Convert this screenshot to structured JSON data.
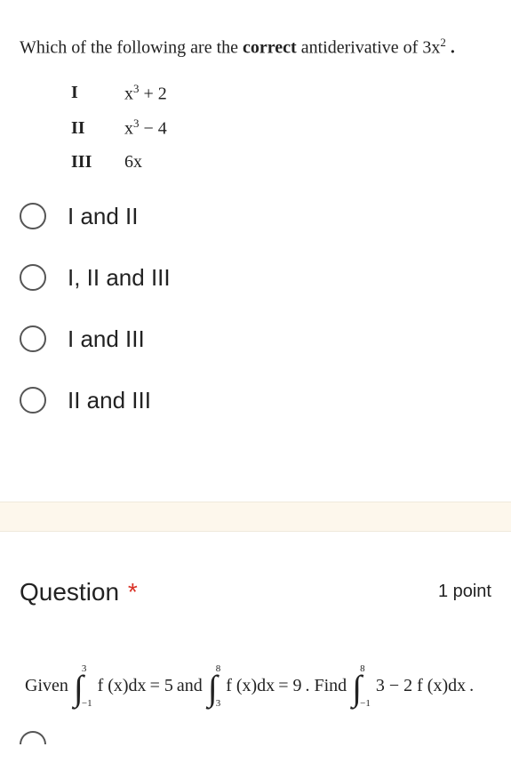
{
  "q1": {
    "stem_pre": "Which  of the following are the ",
    "stem_bold": "correct",
    "stem_post": " antiderivative of ",
    "stem_expr_base": "3x",
    "stem_expr_exp": "2",
    "choices": {
      "I": {
        "num": "I",
        "base": "x",
        "exp": "3",
        "tail": " + 2"
      },
      "II": {
        "num": "II",
        "base": "x",
        "exp": "3",
        "tail": " − 4"
      },
      "III": {
        "num": "III",
        "plain": "6x"
      }
    },
    "radios": {
      "a": "I and II",
      "b": "I, II and III",
      "c": "I and III",
      "d": "II and III"
    }
  },
  "q2": {
    "title": "Question",
    "required_marker": "*",
    "points": "1 point",
    "given": "Given ",
    "int1": {
      "upper": "3",
      "lower": "−1",
      "body": "f (x)dx",
      "eq": " = 5"
    },
    "and": " and ",
    "int2": {
      "upper": "8",
      "lower": "3",
      "body": "f (x)dx",
      "eq": " = 9"
    },
    "find": ". Find ",
    "int3": {
      "upper": "8",
      "lower": "−1",
      "body": "3 − 2 f (x)dx",
      "eq": " ."
    }
  }
}
